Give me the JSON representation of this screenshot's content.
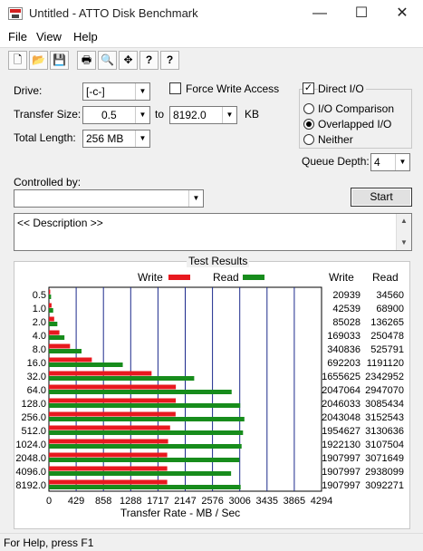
{
  "window": {
    "title": "Untitled - ATTO Disk Benchmark",
    "minimize": "—",
    "maximize": "☐",
    "close": "✕"
  },
  "menu": [
    "File",
    "View",
    "Help"
  ],
  "toolbar": {
    "new": "🗋",
    "open": "📂",
    "save": "💾",
    "print": "🖶",
    "preview": "🔍",
    "move": "✥",
    "help": "?",
    "context_help": "?"
  },
  "settings": {
    "drive_label": "Drive:",
    "drive_value": "[-c-]",
    "transfer_size_label": "Transfer Size:",
    "transfer_from": "0.5",
    "transfer_to_label": "to",
    "transfer_to": "8192.0",
    "transfer_unit": "KB",
    "total_length_label": "Total Length:",
    "total_length_value": "256 MB",
    "force_write_label": "Force Write Access",
    "force_write_checked": false,
    "direct_io_label": "Direct I/O",
    "direct_io_checked": true,
    "io_comparison_label": "I/O Comparison",
    "overlapped_io_label": "Overlapped I/O",
    "neither_label": "Neither",
    "selected_mode": "Overlapped I/O",
    "queue_depth_label": "Queue Depth:",
    "queue_depth_value": "4",
    "controlled_by_label": "Controlled by:",
    "controlled_by_value": "",
    "start_label": "Start",
    "description": "<< Description >>"
  },
  "results": {
    "title": "Test Results",
    "legend_write": "Write",
    "legend_read": "Read",
    "col_write": "Write",
    "col_read": "Read",
    "write_color": "#e8191f",
    "read_color": "#178c1c"
  },
  "chart_data": {
    "type": "bar",
    "orientation": "horizontal",
    "categories": [
      "0.5",
      "1.0",
      "2.0",
      "4.0",
      "8.0",
      "16.0",
      "32.0",
      "64.0",
      "128.0",
      "256.0",
      "512.0",
      "1024.0",
      "2048.0",
      "4096.0",
      "8192.0"
    ],
    "series": [
      {
        "name": "Write",
        "values": [
          20939,
          42539,
          85028,
          169033,
          340836,
          692203,
          1655625,
          2047064,
          2046033,
          2043048,
          1954627,
          1922130,
          1907997,
          1907997,
          1907997
        ]
      },
      {
        "name": "Read",
        "values": [
          34560,
          68900,
          136265,
          250478,
          525791,
          1191120,
          2342952,
          2947070,
          3085434,
          3152543,
          3130636,
          3107504,
          3071649,
          2938099,
          3092271
        ]
      }
    ],
    "xlabel": "Transfer Rate - MB / Sec",
    "xticks": [
      "0",
      "429",
      "858",
      "1288",
      "1717",
      "2147",
      "2576",
      "3006",
      "3435",
      "3865",
      "4294"
    ],
    "xlim": [
      0,
      4294
    ],
    "grid": true,
    "legend_position": "top"
  },
  "status": "For Help, press F1"
}
